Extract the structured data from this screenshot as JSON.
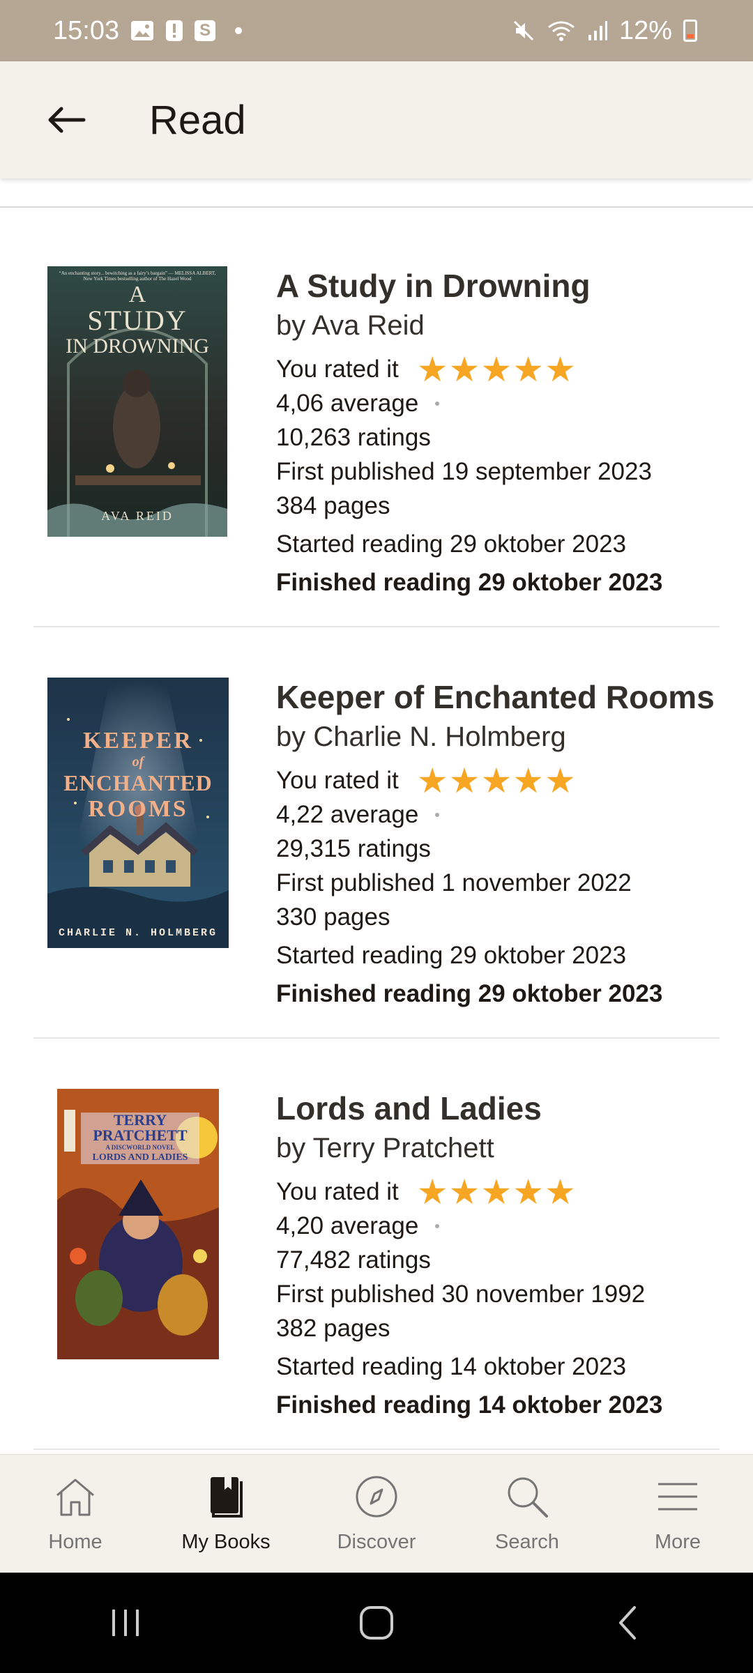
{
  "status_bar": {
    "time": "15:03",
    "notification_letter": "S",
    "battery": "12%",
    "icons": [
      "image-icon",
      "alert-icon",
      "s-app-icon",
      "dot-icon",
      "mute-icon",
      "wifi-icon",
      "signal-icon",
      "battery-icon"
    ]
  },
  "app_bar": {
    "title": "Read"
  },
  "books": [
    {
      "title": "A Study in Drowning",
      "author": "by Ava Reid",
      "rated_label": "You rated it",
      "rating": 5,
      "average": "4,06 average",
      "ratings": "10,263 ratings",
      "published": "First published 19 september 2023",
      "pages": "384 pages",
      "started": "Started reading 29 oktober 2023",
      "finished": "Finished reading 29 oktober 2023",
      "cover": {
        "blurb": "“An enchanting story... bewitching as a fairy’s bargain” — MELISSA ALBERT, New York Times bestselling author of The Hazel Wood",
        "title_lines": [
          "A",
          "STUDY",
          "IN DROWNING"
        ],
        "author": "AVA REID"
      }
    },
    {
      "title": "Keeper of Enchanted Rooms",
      "author": "by Charlie N. Holmberg",
      "rated_label": "You rated it",
      "rating": 5,
      "average": "4,22 average",
      "ratings": "29,315 ratings",
      "published": "First published 1 november 2022",
      "pages": "330 pages",
      "started": "Started reading 29 oktober 2023",
      "finished": "Finished reading 29 oktober 2023",
      "cover": {
        "title_lines": [
          "KEEPER",
          "of",
          "ENCHANTED",
          "ROOMS"
        ],
        "author": "CHARLIE N. HOLMBERG"
      }
    },
    {
      "title": "Lords and Ladies",
      "author": "by Terry Pratchett",
      "rated_label": "You rated it",
      "rating": 5,
      "average": "4,20 average",
      "ratings": "77,482 ratings",
      "published": "First published 30 november 1992",
      "pages": "382 pages",
      "started": "Started reading 14 oktober 2023",
      "finished": "Finished reading 14 oktober 2023",
      "cover": {
        "title_lines": [
          "TERRY",
          "PRATCHETT",
          "A DISCWORLD NOVEL",
          "LORDS AND LADIES"
        ]
      }
    }
  ],
  "bottom_nav": [
    {
      "label": "Home",
      "icon": "home-icon",
      "active": false
    },
    {
      "label": "My Books",
      "icon": "my-books-icon",
      "active": true
    },
    {
      "label": "Discover",
      "icon": "compass-icon",
      "active": false
    },
    {
      "label": "Search",
      "icon": "search-icon",
      "active": false
    },
    {
      "label": "More",
      "icon": "menu-icon",
      "active": false
    }
  ],
  "system_nav": [
    "recents-button",
    "home-button",
    "back-button"
  ],
  "colors": {
    "status_bar": "#b5a794",
    "app_bar": "#f4f1ea",
    "star": "#f6a623",
    "text": "#1e1915"
  }
}
